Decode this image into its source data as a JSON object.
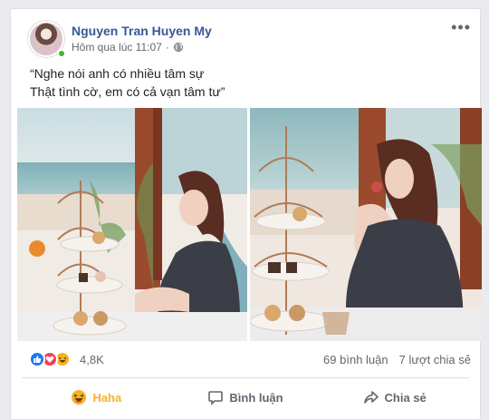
{
  "post": {
    "author": "Nguyen Tran Huyen My",
    "timestamp": "Hôm qua lúc 11:07",
    "separator": "·",
    "privacy_icon": "globe-icon",
    "more_icon": "more-options-icon",
    "more_label": "•••",
    "caption_lines": [
      "“Nghe nói anh có nhiều tâm sự",
      "Thật tình cờ, em có cả vạn tâm tư”"
    ]
  },
  "reactions": {
    "types": [
      "like",
      "love",
      "haha"
    ],
    "count": "4,8K",
    "comments": "69 bình luận",
    "shares": "7 lượt chia sẻ"
  },
  "actions": {
    "haha": "Haha",
    "comment": "Bình luận",
    "share": "Chia sẻ"
  },
  "colors": {
    "author": "#385898",
    "haha_active": "#f7b125",
    "like": "#1877f2",
    "love": "#f33e58",
    "online": "#42b72a"
  }
}
